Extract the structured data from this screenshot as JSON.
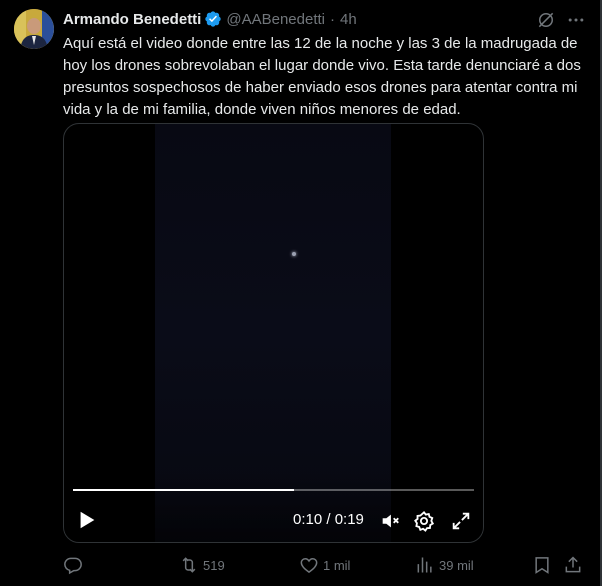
{
  "tweet": {
    "author_name": "Armando Benedetti",
    "handle": "@AABenedetti",
    "separator": "·",
    "time": "4h",
    "text": "Aquí está el video donde entre las 12 de la noche y las 3 de la madrugada de hoy los drones sobrevolaban el lugar donde vivo. Esta tarde denunciaré a dos presuntos sospechosos de haber enviado esos drones para atentar contra mi vida y la de mi familia, donde viven niños menores de edad."
  },
  "video": {
    "time_readout": "0:10 / 0:19",
    "progress": 0.55
  },
  "actions": {
    "reply_count": "",
    "retweet_count": "519",
    "like_count": "1 mil",
    "views_count": "39 mil"
  },
  "colors": {
    "background": "#000000",
    "text": "#e7e9ea",
    "secondary": "#71767b",
    "verified": "#1d9bf0",
    "border": "#2f3336"
  },
  "icons": [
    "avatar",
    "verified-badge-icon",
    "grok-icon",
    "more-icon",
    "play-icon",
    "mute-icon",
    "settings-gear-icon",
    "fullscreen-icon",
    "reply-icon",
    "retweet-icon",
    "like-icon",
    "views-icon",
    "bookmark-icon",
    "share-icon"
  ]
}
